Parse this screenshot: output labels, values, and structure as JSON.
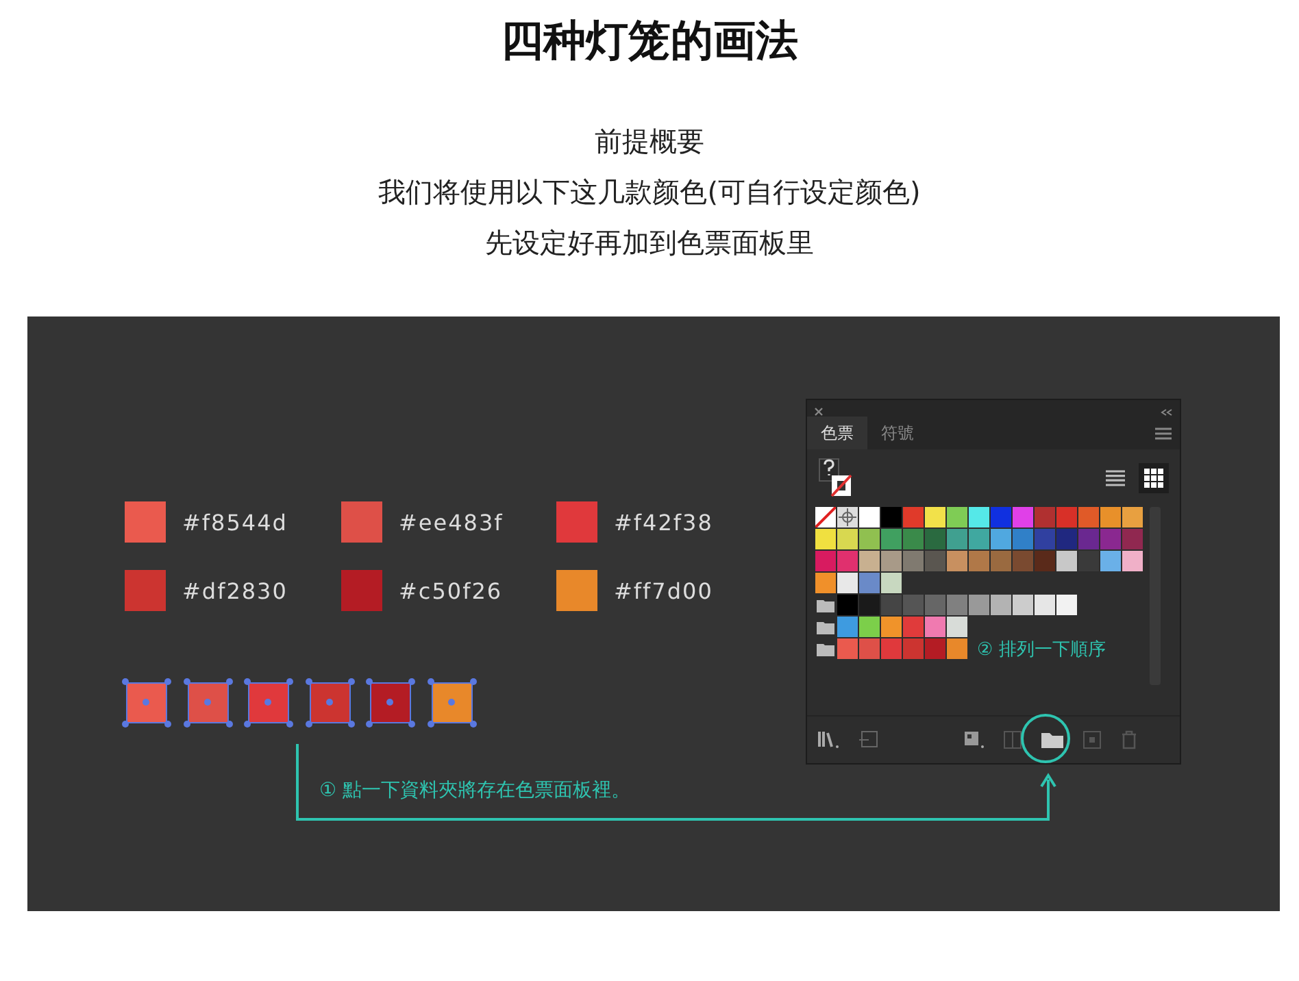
{
  "page": {
    "title": "四种灯笼的画法",
    "intro": [
      "前提概要",
      "我们将使用以下这几款颜色(可自行设定颜色)",
      "先设定好再加到色票面板里"
    ]
  },
  "illustration": {
    "colors": [
      {
        "label": "#f8544d",
        "color": "#ea5a4e"
      },
      {
        "label": "#ee483f",
        "color": "#de5048"
      },
      {
        "label": "#f42f38",
        "color": "#e0393c"
      },
      {
        "label": "#df2830",
        "color": "#cc3430"
      },
      {
        "label": "#c50f26",
        "color": "#b41c24"
      },
      {
        "label": "#ff7d00",
        "color": "#e8882a"
      }
    ],
    "swatches_panel": {
      "tabs": [
        {
          "label": "色票",
          "selected": true
        },
        {
          "label": "符號",
          "selected": false
        }
      ],
      "rows": [
        {
          "swatches": [
            {
              "color": "#ffffff"
            },
            {
              "color": "#000000"
            },
            {
              "color": "#e03a2a"
            },
            {
              "color": "#f2e14a"
            },
            {
              "color": "#7fcc55"
            },
            {
              "color": "#55e8e8"
            },
            {
              "color": "#1030e0"
            },
            {
              "color": "#e040e8"
            },
            {
              "color": "#b03030"
            },
            {
              "color": "#d83028"
            },
            {
              "color": "#e05a28"
            },
            {
              "color": "#e8902a"
            },
            {
              "color": "#e8a040"
            }
          ]
        },
        {
          "swatches": [
            {
              "color": "#f0e040"
            },
            {
              "color": "#d8d850"
            },
            {
              "color": "#90c050"
            },
            {
              "color": "#40a060"
            },
            {
              "color": "#3a8a4a"
            },
            {
              "color": "#2a6a40"
            },
            {
              "color": "#40a090"
            },
            {
              "color": "#40a8a0"
            },
            {
              "color": "#50a8e0"
            },
            {
              "color": "#3080c8"
            },
            {
              "color": "#3040a0"
            },
            {
              "color": "#202880"
            },
            {
              "color": "#6a2890"
            },
            {
              "color": "#8a2890"
            },
            {
              "color": "#902850"
            }
          ]
        },
        {
          "swatches": [
            {
              "color": "#d81b60"
            },
            {
              "color": "#e0306e"
            },
            {
              "color": "#c8b090"
            },
            {
              "color": "#a89a88"
            },
            {
              "color": "#807a70"
            },
            {
              "color": "#5a5650"
            },
            {
              "color": "#c89060"
            },
            {
              "color": "#b07848"
            },
            {
              "color": "#9a6a40"
            },
            {
              "color": "#7a4a30"
            },
            {
              "color": "#5a2a1a"
            },
            {
              "color": "#c8c8c8"
            },
            {
              "color": "#3a3a3a"
            },
            {
              "color": "#6ab0e8"
            },
            {
              "color": "#f0b0c8"
            }
          ]
        },
        {
          "swatches": [
            {
              "color": "#f0902a"
            },
            {
              "color": "#e8e8e8"
            },
            {
              "color": "#6a8ac8"
            },
            {
              "color": "#c8d8c0"
            }
          ]
        }
      ],
      "groups": [
        {
          "swatches": [
            {
              "color": "#000000"
            },
            {
              "color": "#1a1a1a"
            },
            {
              "color": "#454545"
            },
            {
              "color": "#555555"
            },
            {
              "color": "#666666"
            },
            {
              "color": "#808080"
            },
            {
              "color": "#999999"
            },
            {
              "color": "#b3b3b3"
            },
            {
              "color": "#cccccc"
            },
            {
              "color": "#e6e6e6"
            },
            {
              "color": "#f2f2f2"
            }
          ]
        },
        {
          "swatches": [
            {
              "color": "#3e9be0"
            },
            {
              "color": "#7ccf4a"
            },
            {
              "color": "#f0932a"
            },
            {
              "color": "#e03b3b"
            },
            {
              "color": "#f07ab0"
            },
            {
              "color": "#d8dcd8"
            }
          ]
        },
        {
          "swatches": [
            {
              "color": "#ea5a4e"
            },
            {
              "color": "#de5048"
            },
            {
              "color": "#e0393c"
            },
            {
              "color": "#cc3430"
            },
            {
              "color": "#b41c24"
            },
            {
              "color": "#e8882a"
            }
          ]
        }
      ],
      "note_sort": "② 排列一下順序"
    },
    "note_folder": "① 點一下資料夾將存在色票面板裡。"
  }
}
